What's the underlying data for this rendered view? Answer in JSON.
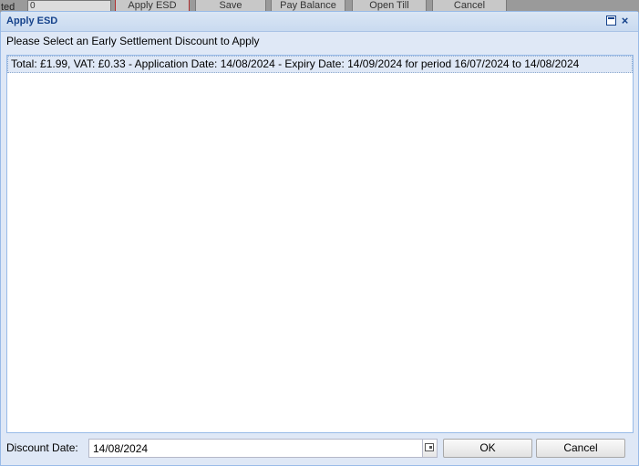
{
  "background": {
    "field_label": "ted",
    "field_value": "0",
    "buttons": [
      "Apply ESD",
      "Save",
      "Pay Balance",
      "Open Till",
      "Cancel"
    ]
  },
  "dialog": {
    "title": "Apply ESD",
    "prompt": "Please Select an Early Settlement Discount to Apply",
    "discounts": [
      "Total: £1.99, VAT: £0.33 - Application Date: 14/08/2024 - Expiry Date: 14/09/2024 for period 16/07/2024 to 14/08/2024"
    ],
    "discount_date_label": "Discount Date:",
    "discount_date_value": "14/08/2024",
    "ok_label": "OK",
    "cancel_label": "Cancel"
  }
}
